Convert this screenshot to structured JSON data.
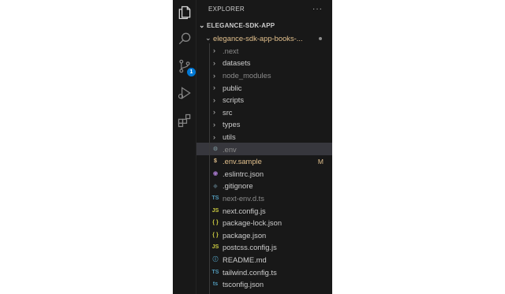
{
  "explorer": {
    "title": "EXPLORER",
    "more": "···"
  },
  "activity": {
    "scm_badge": "1"
  },
  "workspace": {
    "name": "ELEGANCE-SDK-APP"
  },
  "root_folder": {
    "name": "elegance-sdk-app-books-..."
  },
  "folders": [
    {
      "name": ".next",
      "dim": true
    },
    {
      "name": "datasets",
      "dim": false
    },
    {
      "name": "node_modules",
      "dim": true
    },
    {
      "name": "public",
      "dim": false
    },
    {
      "name": "scripts",
      "dim": false
    },
    {
      "name": "src",
      "dim": false
    },
    {
      "name": "types",
      "dim": false
    },
    {
      "name": "utils",
      "dim": false
    }
  ],
  "files": [
    {
      "name": ".env",
      "icon": "gear-icon",
      "glyph": "⚙",
      "color": "#6d8086",
      "dim": true,
      "selected": true
    },
    {
      "name": ".env.sample",
      "icon": "dollar-icon",
      "glyph": "$",
      "color": "#e2c08d",
      "modified": "M"
    },
    {
      "name": ".eslintrc.json",
      "icon": "eslint-icon",
      "glyph": "◉",
      "color": "#a074c4"
    },
    {
      "name": ".gitignore",
      "icon": "git-icon",
      "glyph": "◆",
      "color": "#41535b"
    },
    {
      "name": "next-env.d.ts",
      "icon": "typescript-icon",
      "glyph": "TS",
      "color": "#519aba",
      "dim": true
    },
    {
      "name": "next.config.js",
      "icon": "javascript-icon",
      "glyph": "JS",
      "color": "#cbcb41"
    },
    {
      "name": "package-lock.json",
      "icon": "json-icon",
      "glyph": "{ }",
      "color": "#cbcb41"
    },
    {
      "name": "package.json",
      "icon": "json-icon",
      "glyph": "{ }",
      "color": "#cbcb41"
    },
    {
      "name": "postcss.config.js",
      "icon": "javascript-icon",
      "glyph": "JS",
      "color": "#cbcb41"
    },
    {
      "name": "README.md",
      "icon": "info-icon",
      "glyph": "ⓘ",
      "color": "#519aba"
    },
    {
      "name": "tailwind.config.ts",
      "icon": "typescript-icon",
      "glyph": "TS",
      "color": "#519aba"
    },
    {
      "name": "tsconfig.json",
      "icon": "tsconfig-icon",
      "glyph": "ts",
      "color": "#519aba"
    }
  ]
}
